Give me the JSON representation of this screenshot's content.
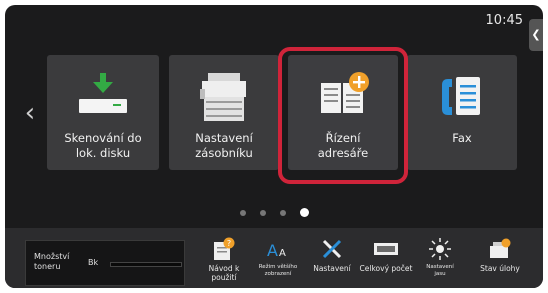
{
  "status": {
    "clock": "10:45"
  },
  "side_tab": {
    "icon": "chevron-left"
  },
  "tiles": [
    {
      "label": "Skenování do\nlok. disku",
      "icon": "scan-to-disk-icon"
    },
    {
      "label": "Nastavení\nzásobníku",
      "icon": "printer-tray-icon"
    },
    {
      "label": "Řízení\nadresáře",
      "icon": "address-book-add-icon",
      "highlighted": true
    },
    {
      "label": "Fax",
      "icon": "fax-icon"
    }
  ],
  "pagination": {
    "pages": 4,
    "current": 4
  },
  "toner": {
    "label": "Množství\ntoneru",
    "color_label": "Bk"
  },
  "bottom_buttons": [
    {
      "label": "Návod k\npoužití",
      "icon": "manual-icon"
    },
    {
      "label": "Režim většího\nzobrazení",
      "icon": "large-text-icon"
    },
    {
      "label": "Nastavení",
      "icon": "settings-tools-icon"
    },
    {
      "label": "Celkový počet",
      "icon": "counter-icon"
    },
    {
      "label": "Nastavení\njasu",
      "icon": "brightness-icon"
    },
    {
      "label": "Stav úlohy",
      "icon": "job-status-icon"
    }
  ],
  "colors": {
    "highlight": "#d0243a",
    "accent_orange": "#f0a02a",
    "accent_green": "#33aa44",
    "accent_blue": "#2a8fd8"
  }
}
